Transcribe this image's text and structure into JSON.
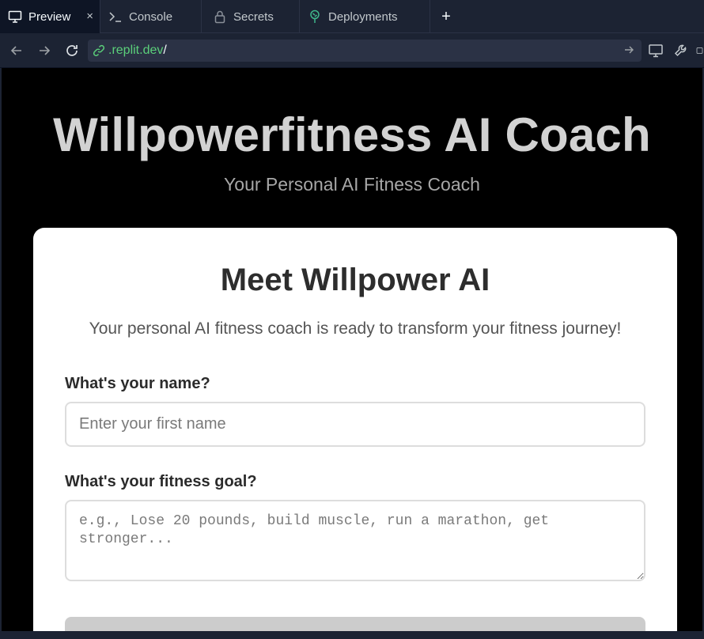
{
  "tabs": [
    {
      "label": "Preview",
      "icon": "monitor-icon",
      "active": true
    },
    {
      "label": "Console",
      "icon": "terminal-icon"
    },
    {
      "label": "Secrets",
      "icon": "lock-icon"
    },
    {
      "label": "Deployments",
      "icon": "deploy-icon"
    }
  ],
  "tab_close_glyph": "×",
  "tab_add_glyph": "+",
  "address": {
    "domain": ".replit.dev",
    "path": "/"
  },
  "page": {
    "title": "Willpowerfitness AI Coach",
    "subtitle": "Your Personal AI Fitness Coach"
  },
  "card": {
    "title": "Meet Willpower AI",
    "description": "Your personal AI fitness coach is ready to transform your fitness journey!",
    "name_label": "What's your name?",
    "name_placeholder": "Enter your first name",
    "goal_label": "What's your fitness goal?",
    "goal_placeholder": "e.g., Lose 20 pounds, build muscle, run a marathon, get stronger..."
  },
  "colors": {
    "ide_bg": "#1c2333",
    "page_bg": "#000000",
    "card_bg": "#ffffff",
    "url_domain": "#5bd07a",
    "deploy_icon": "#3fb68b"
  }
}
